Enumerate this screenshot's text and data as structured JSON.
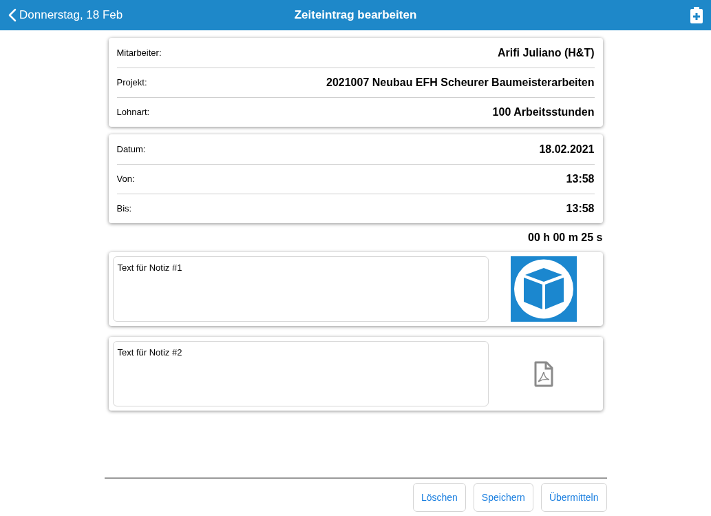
{
  "header": {
    "back": "Donnerstag, 18 Feb",
    "title": "Zeiteintrag bearbeiten"
  },
  "groups": [
    {
      "rows": [
        {
          "label": "Mitarbeiter:",
          "value": "Arifi Juliano (H&T)"
        },
        {
          "label": "Projekt:",
          "value": "2021007 Neubau EFH Scheurer Baumeisterarbeiten"
        },
        {
          "label": "Lohnart:",
          "value": "100 Arbeitsstunden"
        }
      ]
    },
    {
      "rows": [
        {
          "label": "Datum:",
          "value": "18.02.2021"
        },
        {
          "label": "Von:",
          "value": "13:58"
        },
        {
          "label": "Bis:",
          "value": "13:58"
        }
      ]
    }
  ],
  "duration": "00 h 00 m 25 s",
  "notes": [
    {
      "value": "Text für Notiz #1",
      "attachment": {
        "kind": "cube"
      }
    },
    {
      "value": "Text für Notiz #2",
      "attachment": {
        "kind": "pdf"
      }
    }
  ],
  "buttons": [
    "Löschen",
    "Speichern",
    "Übermitteln"
  ]
}
